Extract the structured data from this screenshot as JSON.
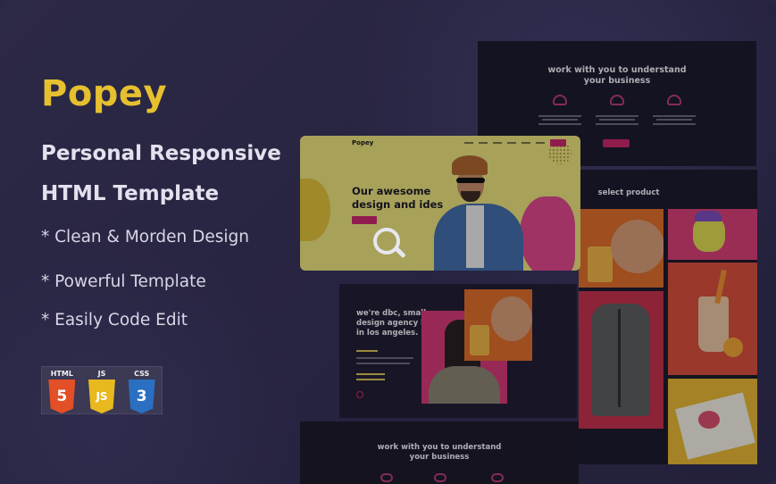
{
  "brand": {
    "name": "Popey",
    "color": "#e6c02e"
  },
  "subtitle": {
    "line1": "Personal Responsive",
    "line2": "HTML Template"
  },
  "features": [
    "* Clean & Morden Design",
    "* Powerful Template",
    "* Easily Code Edit"
  ],
  "tech_badges": [
    {
      "label": "HTML",
      "glyph": "5",
      "color": "#e34f26",
      "icon": "html5-icon"
    },
    {
      "label": "JS",
      "glyph": "JS",
      "color": "#e8b91f",
      "icon": "js-icon"
    },
    {
      "label": "CSS",
      "glyph": "3",
      "color": "#2a6fc2",
      "icon": "css3-icon"
    }
  ],
  "mockup": {
    "services_section": {
      "heading_line1": "work with you to understand",
      "heading_line2": "your business"
    },
    "product_section": {
      "heading": "select product"
    },
    "hero": {
      "logo": "Popey",
      "heading_line1": "Our awesome",
      "heading_line2": "design and ides"
    },
    "about": {
      "heading_line1": "we're dbc, small",
      "heading_line2": "design agency based",
      "heading_line3": "in los angeles."
    },
    "bottom_section": {
      "heading_line1": "work with you to understand",
      "heading_line2": "your business"
    }
  },
  "colors": {
    "accent_pink": "#d6236f",
    "background": "#2a2744",
    "hero_yellow": "#e9e073"
  }
}
